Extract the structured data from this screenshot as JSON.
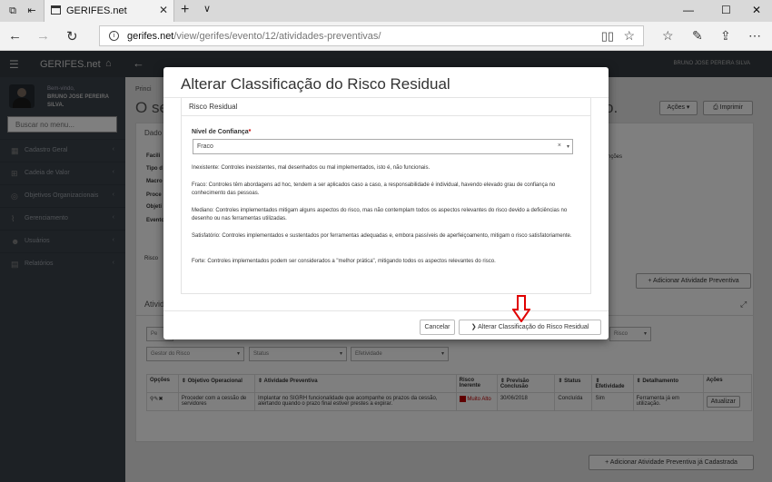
{
  "browser": {
    "tab_title": "GERIFES.net",
    "url_host": "gerifes.net",
    "url_path": "/view/gerifes/evento/12/atividades-preventivas/"
  },
  "app": {
    "brand": "GERIFES.net",
    "top_user": "BRUNO JOSE PEREIRA SILVA"
  },
  "sidebar": {
    "welcome": "Bem-vindo,",
    "user_name": "BRUNO JOSE PEREIRA SILVA.",
    "search_placeholder": "Buscar no menu...",
    "items": [
      {
        "label": "Cadastro Geral",
        "icon": "grid-icon"
      },
      {
        "label": "Cadeia de Valor",
        "icon": "sitemap-icon"
      },
      {
        "label": "Objetivos Organizacionais",
        "icon": "target-icon"
      },
      {
        "label": "Gerenciamento",
        "icon": "chart-icon"
      },
      {
        "label": "Usuários",
        "icon": "users-icon"
      },
      {
        "label": "Relatórios",
        "icon": "report-icon"
      }
    ]
  },
  "page": {
    "crumb": "Princi",
    "title_start": "O se",
    "title_end": "o.",
    "acoes": "Ações ▾",
    "imprimir": "Imprimir",
    "dados": "Dado",
    "left_labels": [
      "Facili",
      "Tipo d",
      "Macro",
      "Proce",
      "Objeti",
      "Evento"
    ],
    "right_snippet": "nções",
    "riscos_tab": "Risco",
    "add_preventiva": "+ Adicionar Atividade Preventiva",
    "atividades": "Ativid",
    "filter_pe": "Pe",
    "filter_risco": "Risco",
    "filters": [
      "Gestor do Risco",
      "Status",
      "Efetividade"
    ],
    "add_cadastrada": "+ Adicionar Atividade Preventiva já Cadastrada",
    "table": {
      "headers": [
        "Opções",
        "Objetivo Operacional",
        "Atividade Preventiva",
        "Risco Inerente",
        "Previsão Conclusão",
        "Status",
        "Efetividade",
        "Detalhamento",
        "Ações"
      ],
      "row": {
        "objetivo": "Proceder com a cessão de servidores",
        "atividade": "Implantar no SIGRH funcionalidade que acompanhe os prazos da cessão, alertando quando o prazo final estiver prestes a expirar.",
        "risco": "Muito Alto",
        "previsao": "30/06/2018",
        "status": "Concluída",
        "efetividade": "Sim",
        "detalhamento": "Ferramenta já em utilização.",
        "acao": "Atualizar"
      }
    }
  },
  "modal": {
    "title": "Alterar Classificação do Risco Residual",
    "section": "Risco Residual",
    "field_label": "Nível de Confiança",
    "required_mark": "*",
    "selected": "Fraco",
    "clear": "×",
    "descriptions": [
      "Inexistente: Controles inexistentes, mal desenhados ou mal implementados, isto é, não funcionais.",
      "Fraco: Controles têm abordagens ad hoc, tendem a ser aplicados caso a caso, a responsabilidade é individual, havendo elevado grau de confiança no conhecimento das pessoas.",
      "Mediano: Controles implementados mitigam alguns aspectos do risco, mas não contemplam todos os aspectos relevantes do risco devido a deficiências no desenho ou nas ferramentas utilizadas.",
      "Satisfatório: Controles implementados e sustentados por ferramentas adequadas e, embora passíveis de aperfeiçoamento, mitigam o risco satisfatoriamente.",
      "Forte: Controles implementados podem ser considerados a \"melhor prática\", mitigando todos os aspectos relevantes do risco."
    ],
    "cancel": "Cancelar",
    "confirm": "❯ Alterar Classificação do Risco Residual"
  },
  "colors": {
    "accent_arrow": "#e00000",
    "risk_high": "#c00000"
  }
}
